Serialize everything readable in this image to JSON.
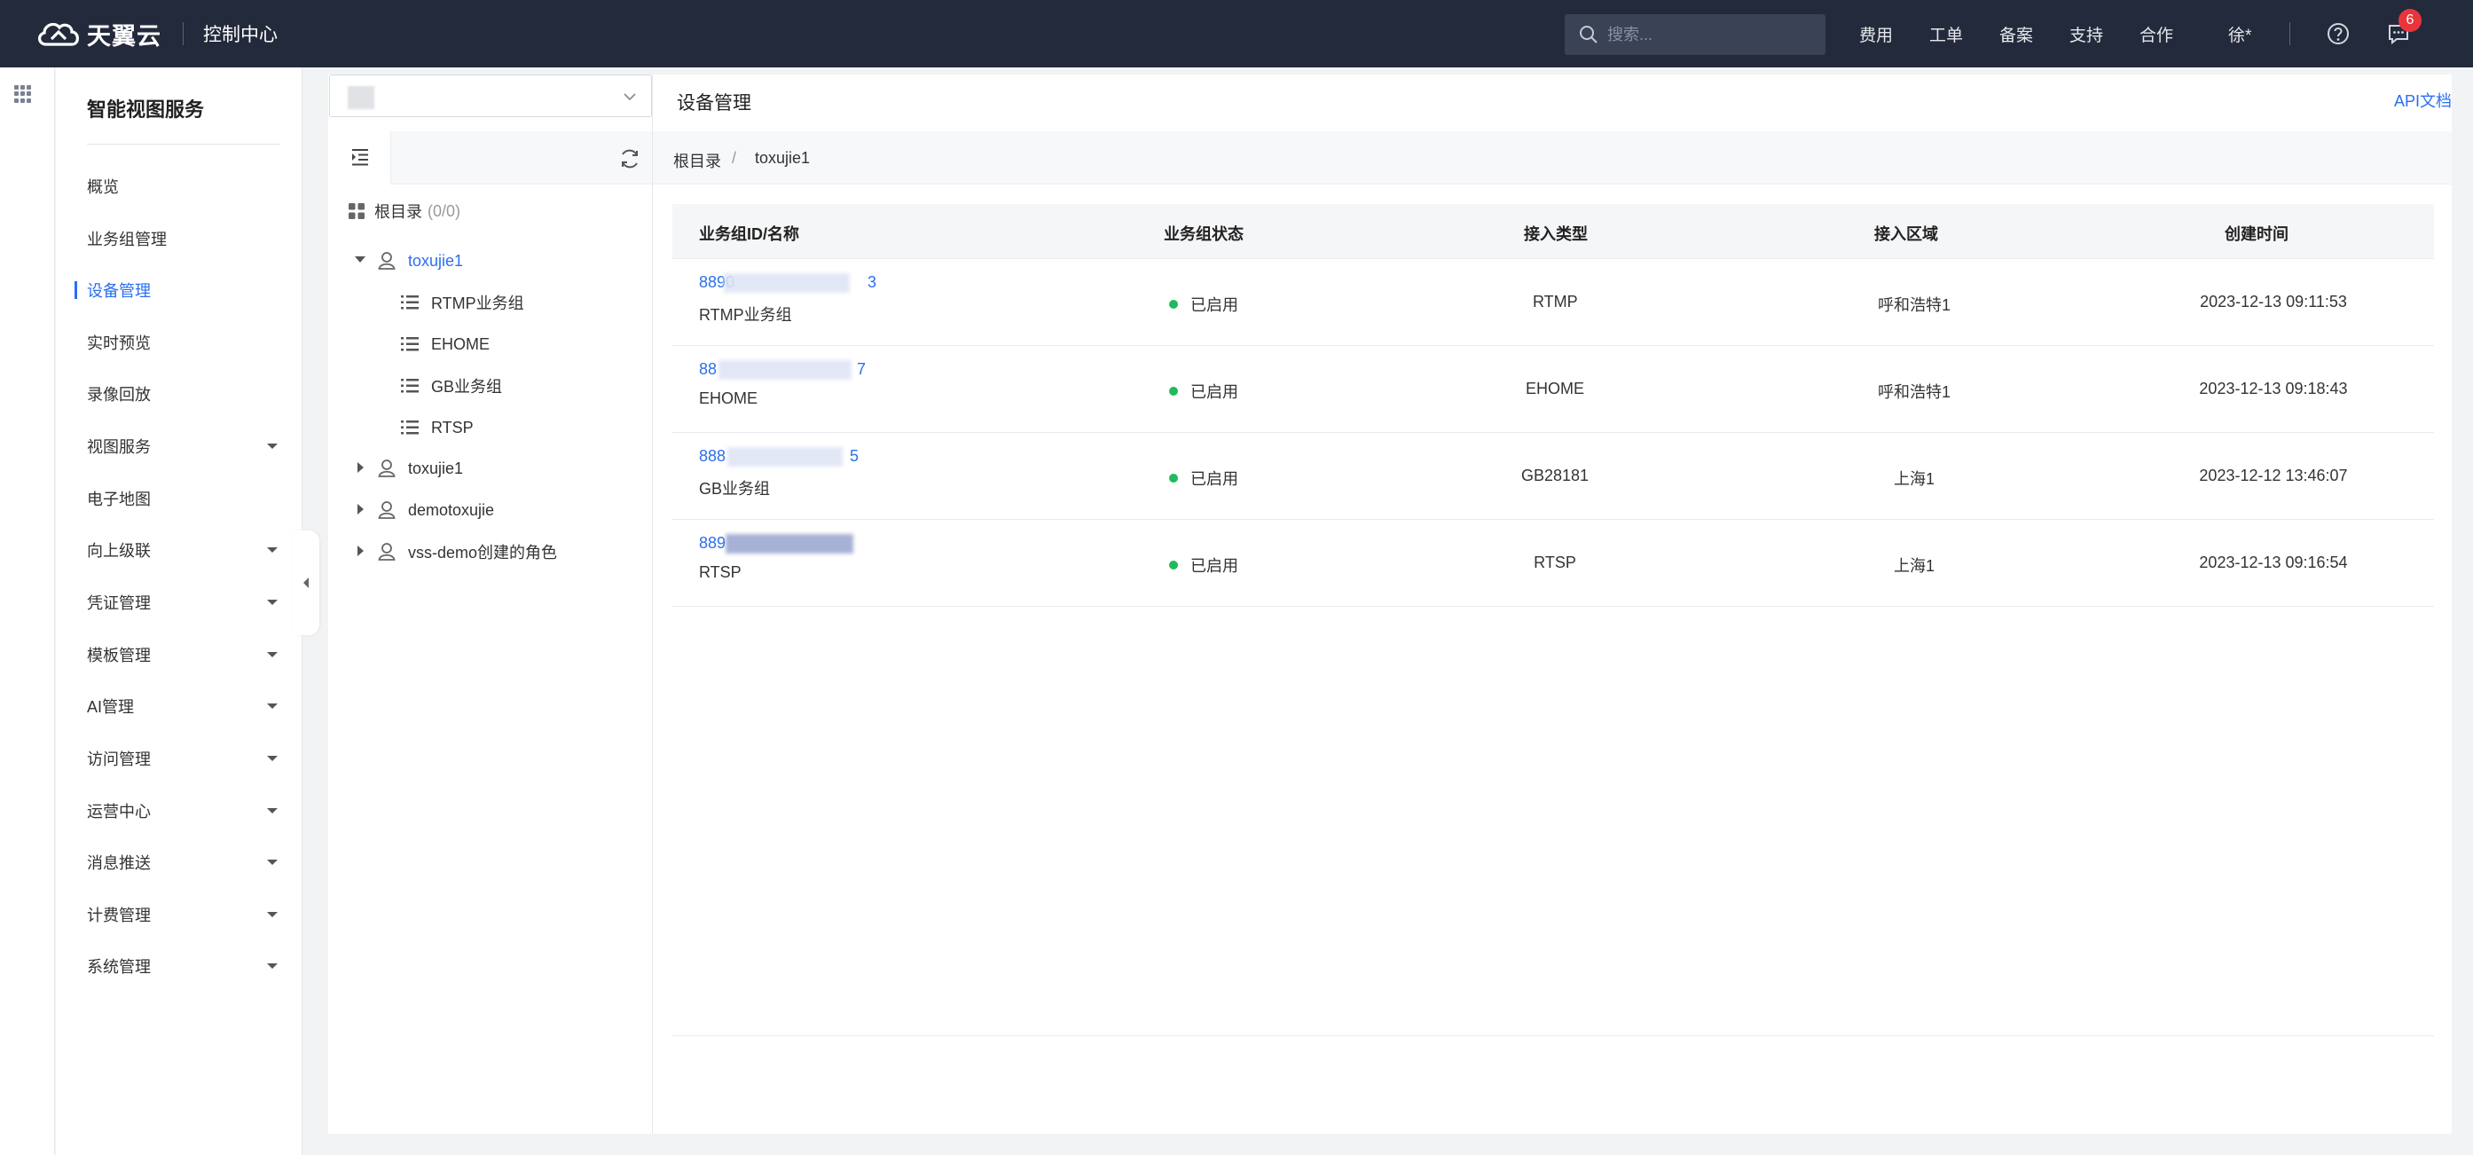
{
  "header": {
    "brand": "天翼云",
    "console": "控制中心",
    "search_placeholder": "搜索...",
    "links": [
      "费用",
      "工单",
      "备案",
      "支持",
      "合作"
    ],
    "user": "徐*",
    "message_count": "6"
  },
  "sidebar": {
    "title": "智能视图服务",
    "items": [
      {
        "label": "概览",
        "expandable": false
      },
      {
        "label": "业务组管理",
        "expandable": false
      },
      {
        "label": "设备管理",
        "expandable": false,
        "active": true
      },
      {
        "label": "实时预览",
        "expandable": false
      },
      {
        "label": "录像回放",
        "expandable": false
      },
      {
        "label": "视图服务",
        "expandable": true
      },
      {
        "label": "电子地图",
        "expandable": false
      },
      {
        "label": "向上级联",
        "expandable": true
      },
      {
        "label": "凭证管理",
        "expandable": true
      },
      {
        "label": "模板管理",
        "expandable": true
      },
      {
        "label": "AI管理",
        "expandable": true
      },
      {
        "label": "访问管理",
        "expandable": true
      },
      {
        "label": "运营中心",
        "expandable": true
      },
      {
        "label": "消息推送",
        "expandable": true
      },
      {
        "label": "计费管理",
        "expandable": true
      },
      {
        "label": "系统管理",
        "expandable": true
      }
    ]
  },
  "page": {
    "title": "设备管理",
    "api_link": "API文档"
  },
  "tree": {
    "root_label": "根目录",
    "root_count": "(0/0)",
    "nodes": [
      {
        "label": "toxujie1",
        "type": "user",
        "expanded": true,
        "active": true
      },
      {
        "label": "RTMP业务组",
        "type": "group"
      },
      {
        "label": "EHOME",
        "type": "group"
      },
      {
        "label": "GB业务组",
        "type": "group"
      },
      {
        "label": "RTSP",
        "type": "group"
      },
      {
        "label": "toxujie1",
        "type": "user",
        "expanded": false
      },
      {
        "label": "demotoxujie",
        "type": "user",
        "expanded": false
      },
      {
        "label": "vss-demo创建的角色",
        "type": "user",
        "expanded": false
      }
    ]
  },
  "breadcrumb": {
    "root": "根目录",
    "separator": "/",
    "current": "toxujie1"
  },
  "table": {
    "columns": [
      "业务组ID/名称",
      "业务组状态",
      "接入类型",
      "接入区域",
      "创建时间"
    ],
    "rows": [
      {
        "id_prefix": "8890",
        "id_suffix": "3",
        "name": "RTMP业务组",
        "status": "已启用",
        "type": "RTMP",
        "region": "呼和浩特1",
        "created": "2023-12-13 09:11:53"
      },
      {
        "id_prefix": "88",
        "id_suffix": "7",
        "name": "EHOME",
        "status": "已启用",
        "type": "EHOME",
        "region": "呼和浩特1",
        "created": "2023-12-13 09:18:43"
      },
      {
        "id_prefix": "888",
        "id_suffix": "5",
        "name": "GB业务组",
        "status": "已启用",
        "type": "GB28181",
        "region": "上海1",
        "created": "2023-12-12 13:46:07"
      },
      {
        "id_prefix": "889",
        "id_suffix": "",
        "name": "RTSP",
        "status": "已启用",
        "type": "RTSP",
        "region": "上海1",
        "created": "2023-12-13 09:16:54"
      }
    ]
  },
  "colors": {
    "topbar": "#232a3b",
    "accent": "#2b6fef",
    "status_enabled": "#1fbb5c",
    "badge": "#e8353c"
  }
}
